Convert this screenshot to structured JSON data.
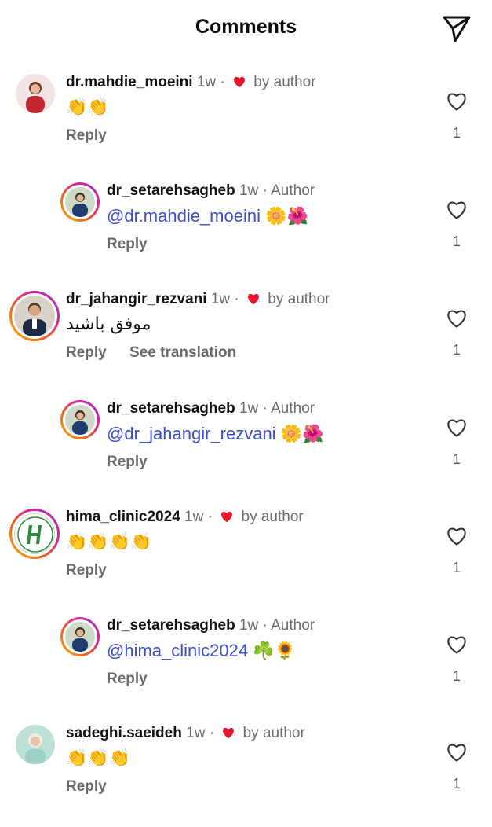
{
  "header": {
    "title": "Comments"
  },
  "reply_label": "Reply",
  "see_translation_label": "See translation",
  "comments": [
    {
      "user": "dr.mahdie_moeini",
      "time": "1w",
      "sep": "·",
      "liked_by_author": true,
      "by_author": "by author",
      "text": "👏👏",
      "likes": "1"
    },
    {
      "user": "dr_setarehsagheb",
      "time": "1w",
      "sep": "·",
      "author_label": "Author",
      "mention": "@dr.mahdie_moeini",
      "text": "🌼🌺",
      "likes": "1"
    },
    {
      "user": "dr_jahangir_rezvani",
      "time": "1w",
      "sep": "·",
      "liked_by_author": true,
      "by_author": "by author",
      "text": "موفق باشید",
      "likes": "1"
    },
    {
      "user": "dr_setarehsagheb",
      "time": "1w",
      "sep": "·",
      "author_label": "Author",
      "mention": "@dr_jahangir_rezvani",
      "text": "🌼🌺",
      "likes": "1"
    },
    {
      "user": "hima_clinic2024",
      "time": "1w",
      "sep": "·",
      "liked_by_author": true,
      "by_author": "by author",
      "text": "👏👏👏👏",
      "likes": "1"
    },
    {
      "user": "dr_setarehsagheb",
      "time": "1w",
      "sep": "·",
      "author_label": "Author",
      "mention": "@hima_clinic2024",
      "text": "☘️🌻",
      "likes": "1"
    },
    {
      "user": "sadeghi.saeideh",
      "time": "1w",
      "sep": "·",
      "liked_by_author": true,
      "by_author": "by author",
      "text": "👏👏👏",
      "likes": "1"
    }
  ],
  "icons": {
    "send": "paper-plane-icon",
    "like": "heart-outline-icon",
    "author_like": "red-heart-icon"
  },
  "colors": {
    "mention": "#3b4ec9",
    "heart": "#e8162b",
    "muted": "#6b6b6b"
  }
}
